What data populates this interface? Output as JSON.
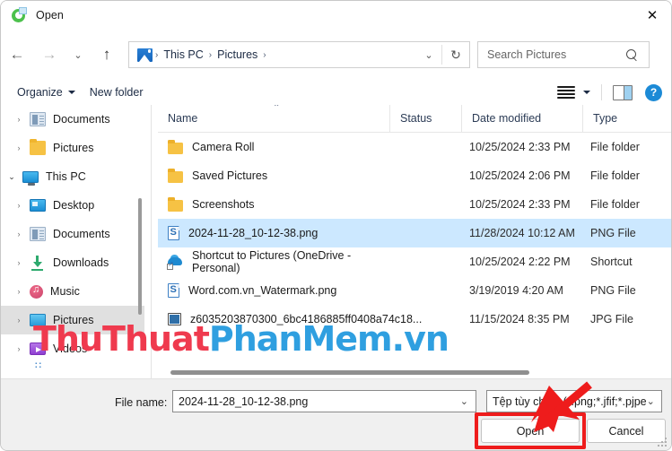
{
  "window": {
    "title": "Open",
    "title_icon": "snipping-tool-icon",
    "close_label": "✕"
  },
  "nav": {
    "back_icon": "←",
    "forward_icon": "→",
    "recent_icon": "⌄",
    "up_icon": "↑",
    "address_icon": "pictures-folder-icon",
    "breadcrumbs": [
      "This PC",
      "Pictures"
    ],
    "separator": "›",
    "history_chevron": "⌄",
    "refresh_icon": "↻",
    "search_placeholder": "Search Pictures"
  },
  "commandbar": {
    "organize_label": "Organize",
    "new_folder_label": "New folder",
    "view_icon": "view-list-icon",
    "view_caret": "▾",
    "preview_pane_icon": "preview-pane-icon",
    "help_label": "?"
  },
  "sidebar": {
    "items": [
      {
        "label": "Documents",
        "icon": "documents-icon",
        "expand": "›",
        "indent": 1,
        "selected": false
      },
      {
        "label": "Pictures",
        "icon": "folder-icon",
        "expand": "›",
        "indent": 1,
        "selected": false
      },
      {
        "label": "This PC",
        "icon": "this-pc-icon",
        "expand": "⌄",
        "indent": 0,
        "selected": false
      },
      {
        "label": "Desktop",
        "icon": "desktop-icon",
        "expand": "›",
        "indent": 1,
        "selected": false
      },
      {
        "label": "Documents",
        "icon": "documents-icon",
        "expand": "›",
        "indent": 1,
        "selected": false
      },
      {
        "label": "Downloads",
        "icon": "downloads-icon",
        "expand": "›",
        "indent": 1,
        "selected": false
      },
      {
        "label": "Music",
        "icon": "music-icon",
        "expand": "›",
        "indent": 1,
        "selected": false
      },
      {
        "label": "Pictures",
        "icon": "pictures-icon",
        "expand": "›",
        "indent": 1,
        "selected": true
      },
      {
        "label": "Videos",
        "icon": "videos-icon",
        "expand": "›",
        "indent": 1,
        "selected": false
      }
    ],
    "overflow_dots": "∷"
  },
  "filelist": {
    "columns": [
      "Name",
      "Status",
      "Date modified",
      "Type"
    ],
    "sort_indicator": "⌃",
    "rows": [
      {
        "name": "Camera Roll",
        "icon": "folder-icon",
        "status": "",
        "date": "10/25/2024 2:33 PM",
        "type": "File folder",
        "selected": false
      },
      {
        "name": "Saved Pictures",
        "icon": "folder-icon",
        "status": "",
        "date": "10/25/2024 2:06 PM",
        "type": "File folder",
        "selected": false
      },
      {
        "name": "Screenshots",
        "icon": "folder-icon",
        "status": "",
        "date": "10/25/2024 2:33 PM",
        "type": "File folder",
        "selected": false
      },
      {
        "name": "2024-11-28_10-12-38.png",
        "icon": "png-file-icon",
        "status": "",
        "date": "11/28/2024 10:12 AM",
        "type": "PNG File",
        "selected": true
      },
      {
        "name": "Shortcut to Pictures (OneDrive - Personal)",
        "icon": "onedrive-shortcut-icon",
        "status": "",
        "date": "10/25/2024 2:22 PM",
        "type": "Shortcut",
        "selected": false
      },
      {
        "name": "Word.com.vn_Watermark.png",
        "icon": "png-file-icon",
        "status": "",
        "date": "3/19/2019 4:20 AM",
        "type": "PNG File",
        "selected": false
      },
      {
        "name": "z6035203870300_6bc4186885ff0408a74c18...",
        "icon": "image-file-icon",
        "status": "",
        "date": "11/15/2024 8:35 PM",
        "type": "JPG File",
        "selected": false
      }
    ]
  },
  "footer": {
    "filename_label": "File name:",
    "filename_value": "2024-11-28_10-12-38.png",
    "filename_chevron": "⌄",
    "filetype_value": "Tệp tùy chỉnh (*.png;*.jfif;*.pjpe",
    "filetype_chevron": "⌄",
    "open_label": "Open",
    "cancel_label": "Cancel"
  },
  "annotation": {
    "highlight_color": "#ee1c1c",
    "arrow_color": "#ee1c1c",
    "target": "Open"
  },
  "watermark": {
    "part1": "ThuThuat",
    "part2": "PhanMem.vn",
    "color1": "#ef3a4e",
    "color2": "#2f9fe0"
  }
}
